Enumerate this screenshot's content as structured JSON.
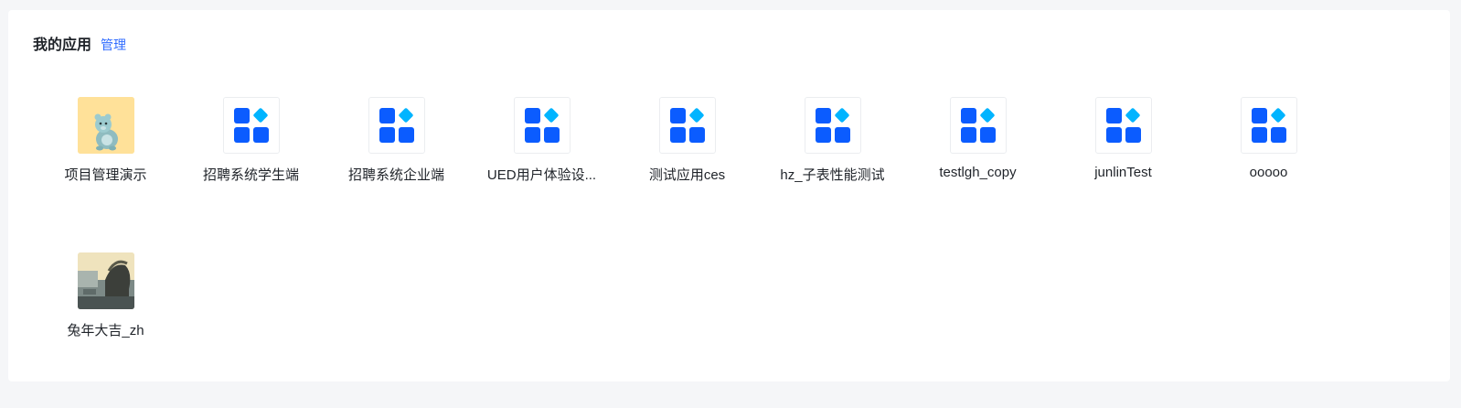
{
  "header": {
    "title": "我的应用",
    "manage_label": "管理"
  },
  "colors": {
    "accent": "#2f6bff",
    "icon_primary": "#0b5cff",
    "icon_diamond": "#00b4ff",
    "bear_bg": "#ffe199"
  },
  "apps": [
    {
      "name": "项目管理演示",
      "icon": "bear-photo-icon"
    },
    {
      "name": "招聘系统学生端",
      "icon": "app-grid-icon"
    },
    {
      "name": "招聘系统企业端",
      "icon": "app-grid-icon"
    },
    {
      "name": "UED用户体验设...",
      "icon": "app-grid-icon"
    },
    {
      "name": "测试应用ces",
      "icon": "app-grid-icon"
    },
    {
      "name": "hz_子表性能测试",
      "icon": "app-grid-icon"
    },
    {
      "name": "testlgh_copy",
      "icon": "app-grid-icon"
    },
    {
      "name": "junlinTest",
      "icon": "app-grid-icon"
    },
    {
      "name": "ooooo",
      "icon": "app-grid-icon"
    },
    {
      "name": "兔年大吉_zh",
      "icon": "scene-photo-icon"
    }
  ]
}
